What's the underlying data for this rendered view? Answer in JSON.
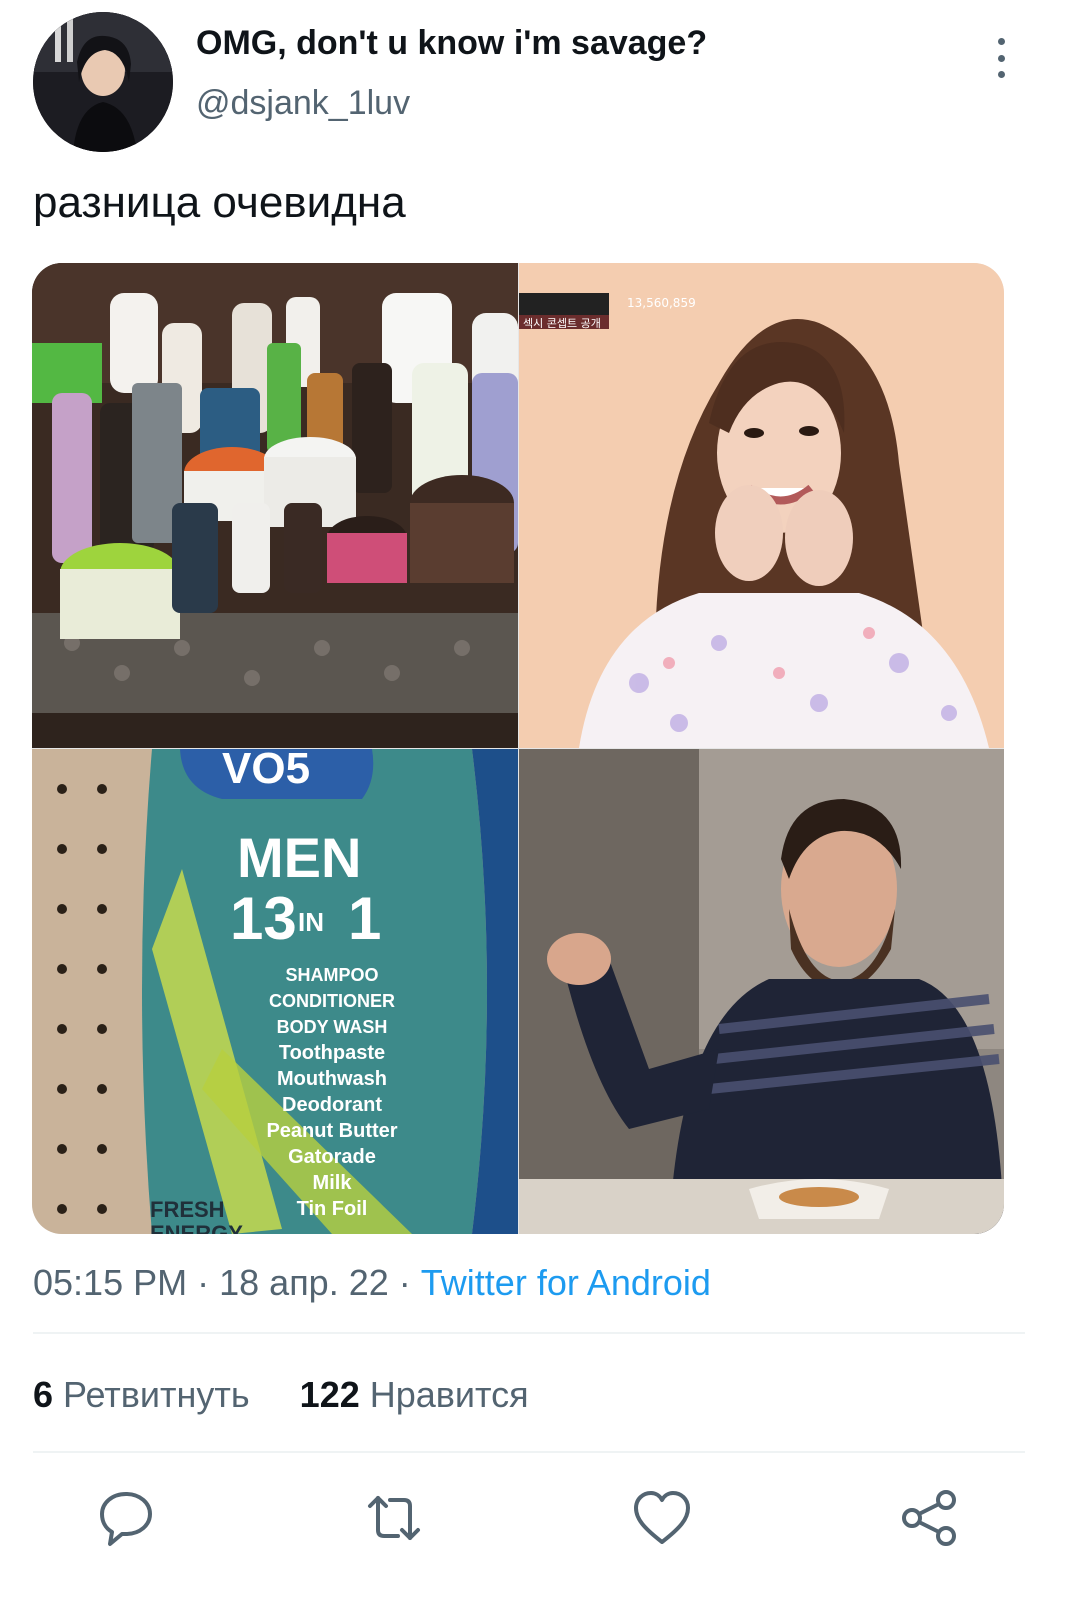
{
  "tweet": {
    "display_name": "OMG, don't u know i'm savage?",
    "handle": "@dsjank_1luv",
    "text": "разница очевидна",
    "time": "05:15 PM",
    "date": "18 апр. 22",
    "separator": "·",
    "source": "Twitter for Android"
  },
  "media": {
    "top_right_overlay": {
      "caption": "섹시 콘셉트 공개",
      "count": "13,560,859"
    },
    "bottle": {
      "brand": "VO5",
      "line1": "MEN",
      "line2": "13",
      "line2_small": "IN",
      "line2_end": "1",
      "list": [
        "SHAMPOO",
        "CONDITIONER",
        "BODY WASH",
        "Toothpaste",
        "Mouthwash",
        "Deodorant",
        "Peanut Butter",
        "Gatorade",
        "Milk",
        "Tin Foil"
      ],
      "badge": "FRESH",
      "badge2": "ENERGY"
    }
  },
  "stats": {
    "retweets_count": "6",
    "retweets_label": "Ретвитнуть",
    "likes_count": "122",
    "likes_label": "Нравится"
  },
  "icons": {
    "reply": "reply-icon",
    "retweet": "retweet-icon",
    "like": "heart-icon",
    "share": "share-icon",
    "more": "more-vertical-icon"
  },
  "colors": {
    "accent": "#1d9bf0",
    "secondary_text": "#536471"
  }
}
